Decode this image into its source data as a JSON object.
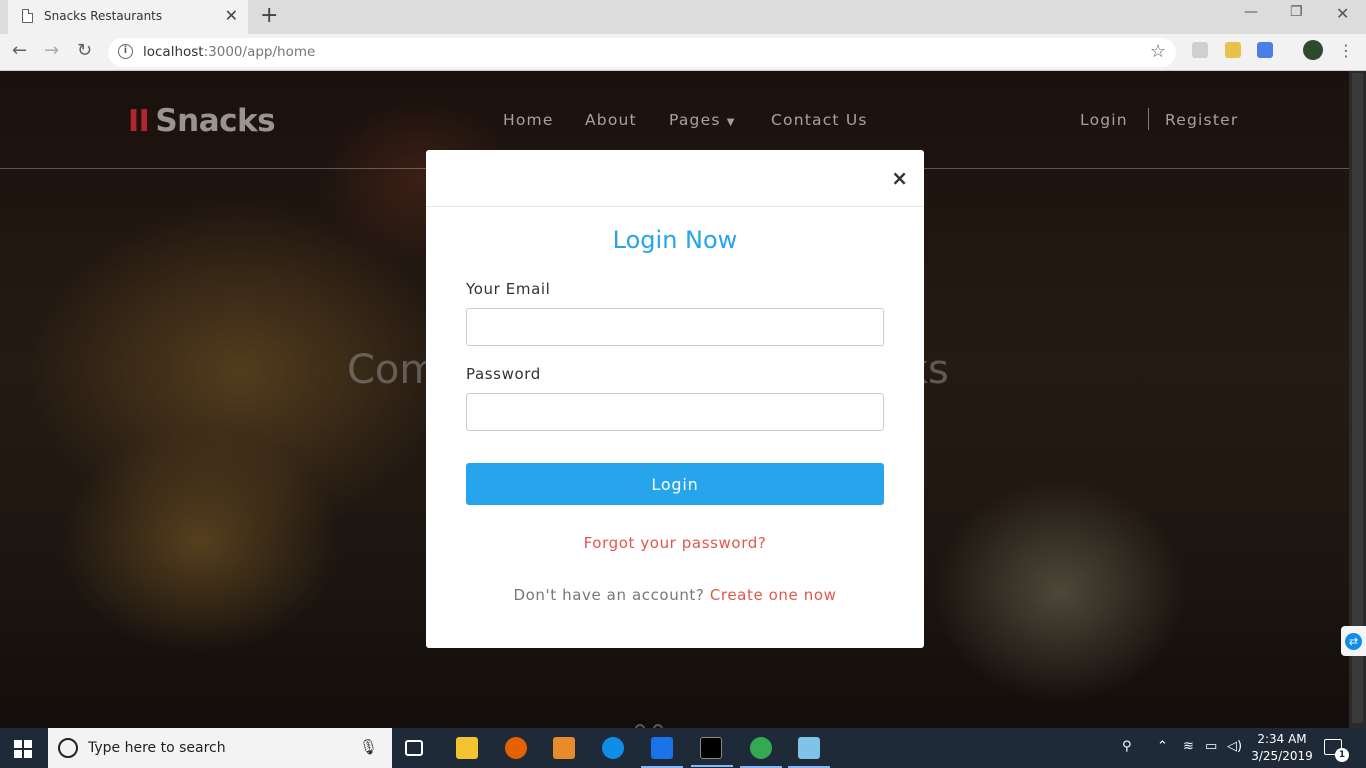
{
  "browser": {
    "tab_title": "Snacks Restaurants",
    "url_host": "localhost",
    "url_rest": ":3000/app/home"
  },
  "site": {
    "logo_text": "Snacks",
    "nav": [
      "Home",
      "About",
      "Pages",
      "Contact Us"
    ],
    "login": "Login",
    "register": "Register",
    "hero_left": "Com",
    "hero_right": "acks"
  },
  "modal": {
    "close": "×",
    "title": "Login Now",
    "email_label": "Your Email",
    "email_value": "",
    "password_label": "Password",
    "password_value": "",
    "login_button": "Login",
    "forgot": "Forgot your password?",
    "no_account": "Don't have an account?",
    "create": "Create one now"
  },
  "taskbar": {
    "search_placeholder": "Type here to search",
    "time": "2:34 AM",
    "date": "3/25/2019",
    "notification_count": "1",
    "apps": [
      "task-view-icon",
      "file-explorer-icon",
      "firefox-icon",
      "media-player-icon",
      "teamviewer-icon",
      "webstorm-icon",
      "terminal-icon",
      "chrome-icon",
      "notepad-icon"
    ]
  },
  "colors": {
    "accent_blue": "#26a4ec",
    "link_red": "#e2574c",
    "logo_red": "#b3262e"
  }
}
